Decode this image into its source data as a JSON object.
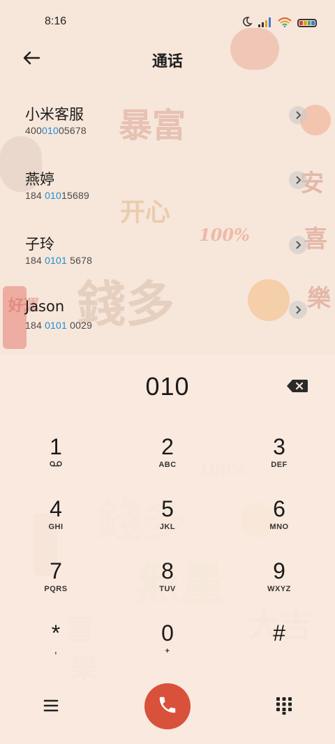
{
  "status": {
    "time": "8:16",
    "icons": [
      "moon-icon",
      "signal-icon",
      "wifi-icon",
      "battery-icon"
    ]
  },
  "header": {
    "title": "通话",
    "back_icon": "arrow-left-icon"
  },
  "contacts": [
    {
      "name": "小米客服",
      "num_pre": "400",
      "num_hl": "010",
      "num_post": "05678"
    },
    {
      "name": "燕婷",
      "num_pre": "184 ",
      "num_hl": "010",
      "num_post": "15689"
    },
    {
      "name": "子玲",
      "num_pre": "184 ",
      "num_hl": "0101",
      "num_post": " 5678"
    },
    {
      "name": "Jason",
      "num_pre": "184 ",
      "num_hl": "0101",
      "num_post": " 0029"
    }
  ],
  "dialer": {
    "number": "010",
    "backspace_icon": "backspace-icon"
  },
  "keys": [
    {
      "digit": "1",
      "sub": ""
    },
    {
      "digit": "2",
      "sub": "ABC"
    },
    {
      "digit": "3",
      "sub": "DEF"
    },
    {
      "digit": "4",
      "sub": "GHI"
    },
    {
      "digit": "5",
      "sub": "JKL"
    },
    {
      "digit": "6",
      "sub": "MNO"
    },
    {
      "digit": "7",
      "sub": "PQRS"
    },
    {
      "digit": "8",
      "sub": "TUV"
    },
    {
      "digit": "9",
      "sub": "WXYZ"
    },
    {
      "digit": "*",
      "sub": ","
    },
    {
      "digit": "0",
      "sub": "+"
    },
    {
      "digit": "#",
      "sub": ""
    }
  ],
  "bottom": {
    "menu_icon": "hamburger-menu-icon",
    "call_icon": "phone-icon",
    "keypad_icon": "dialpad-icon"
  },
  "colors": {
    "background": "#f7e6da",
    "highlight": "#1a8fd8",
    "call_button": "#d9513a"
  },
  "wallpaper_text": [
    "暴富",
    "开心",
    "100%",
    "安",
    "喜",
    "樂",
    "錢多",
    "無量",
    "大吉",
    "好運"
  ]
}
